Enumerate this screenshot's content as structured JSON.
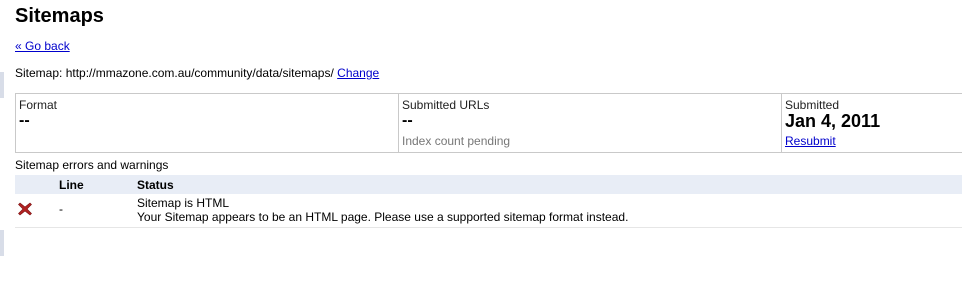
{
  "page": {
    "title": "Sitemaps",
    "back_link": "« Go back"
  },
  "sitemap": {
    "label": "Sitemap: http://mmazone.com.au/community/data/sitemaps/",
    "change_link": "Change"
  },
  "summary": {
    "format": {
      "label": "Format",
      "value": "--"
    },
    "submitted_urls": {
      "label": "Submitted URLs",
      "value": "--",
      "note": "Index count pending"
    },
    "submitted": {
      "label": "Submitted",
      "date": "Jan 4, 2011",
      "resubmit_link": "Resubmit"
    }
  },
  "errors": {
    "heading": "Sitemap errors and warnings",
    "columns": {
      "line": "Line",
      "status": "Status"
    },
    "rows": [
      {
        "icon": "error-x-icon",
        "line": "-",
        "status_title": "Sitemap is HTML",
        "status_message": "Your Sitemap appears to be an HTML page. Please use a supported sitemap format instead."
      }
    ]
  },
  "colors": {
    "link": "#0000cc",
    "header_row_bg": "#e8edf6",
    "error_icon": "#b22222",
    "border": "#c9c9c9"
  }
}
